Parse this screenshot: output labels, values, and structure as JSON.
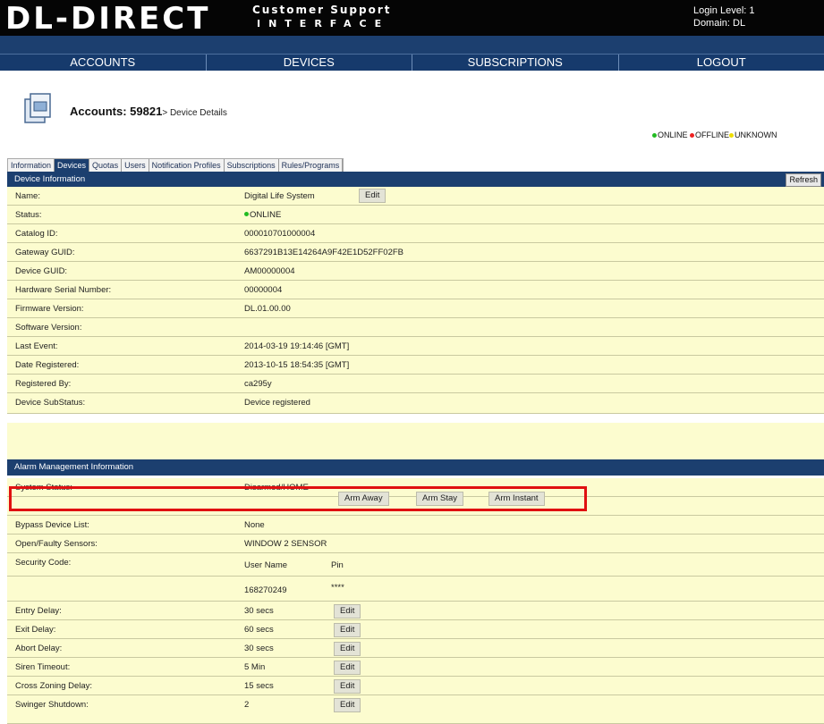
{
  "header": {
    "logo": "DL-DIRECT",
    "logo_line1": "Customer Support",
    "logo_line2": "INTERFACE",
    "login_level": "Login Level: 1",
    "domain": "Domain: DL"
  },
  "nav": {
    "accounts": "ACCOUNTS",
    "devices": "DEVICES",
    "subscriptions": "SUBSCRIPTIONS",
    "logout": "LOGOUT"
  },
  "breadcrumb": {
    "main": "Accounts: 59821",
    "sub": "> Device Details"
  },
  "legend": {
    "online": "ONLINE",
    "offline": "OFFLINE",
    "unknown": "UNKNOWN",
    "online_color": "#22bb22",
    "offline_color": "#ee2222",
    "unknown_color": "#eedd00"
  },
  "tabs": [
    "Information",
    "Devices",
    "Quotas",
    "Users",
    "Notification Profiles",
    "Subscriptions",
    "Rules/Programs"
  ],
  "device_info": {
    "title": "Device Information",
    "refresh": "Refresh",
    "edit": "Edit",
    "rows": [
      {
        "label": "Name:",
        "value": "Digital Life System"
      },
      {
        "label": "Status:",
        "value": "ONLINE"
      },
      {
        "label": "Catalog ID:",
        "value": "000010701000004"
      },
      {
        "label": "Gateway GUID:",
        "value": "6637291B13E14264A9F42E1D52FF02FB"
      },
      {
        "label": "Device GUID:",
        "value": "AM00000004"
      },
      {
        "label": "Hardware Serial Number:",
        "value": "00000004"
      },
      {
        "label": "Firmware Version:",
        "value": "DL.01.00.00"
      },
      {
        "label": "Software Version:",
        "value": ""
      },
      {
        "label": "Last Event:",
        "value": "2014-03-19 19:14:46 [GMT]"
      },
      {
        "label": "Date Registered:",
        "value": "2013-10-15 18:54:35 [GMT]"
      },
      {
        "label": "Registered By:",
        "value": "ca295y"
      },
      {
        "label": "Device SubStatus:",
        "value": "Device registered"
      }
    ]
  },
  "alarm": {
    "title": "Alarm Management Information",
    "system_status_label": "System Status:",
    "system_status_value": "Disarmed/HOME",
    "arm_away": "Arm Away",
    "arm_stay": "Arm Stay",
    "arm_instant": "Arm Instant",
    "bypass_label": "Bypass Device List:",
    "bypass_value": "None",
    "faulty_label": "Open/Faulty Sensors:",
    "faulty_value": "WINDOW 2 SENSOR",
    "security_label": "Security Code:",
    "user_name_header": "User Name",
    "pin_header": "Pin",
    "user_name": "168270249",
    "pin": "****",
    "edit": "Edit",
    "delays": [
      {
        "label": "Entry Delay:",
        "value": "30 secs"
      },
      {
        "label": "Exit Delay:",
        "value": "60 secs"
      },
      {
        "label": "Abort Delay:",
        "value": "30 secs"
      },
      {
        "label": "Siren Timeout:",
        "value": "5 Min"
      },
      {
        "label": "Cross Zoning Delay:",
        "value": "15 secs"
      },
      {
        "label": "Swinger Shutdown:",
        "value": "2"
      }
    ]
  }
}
